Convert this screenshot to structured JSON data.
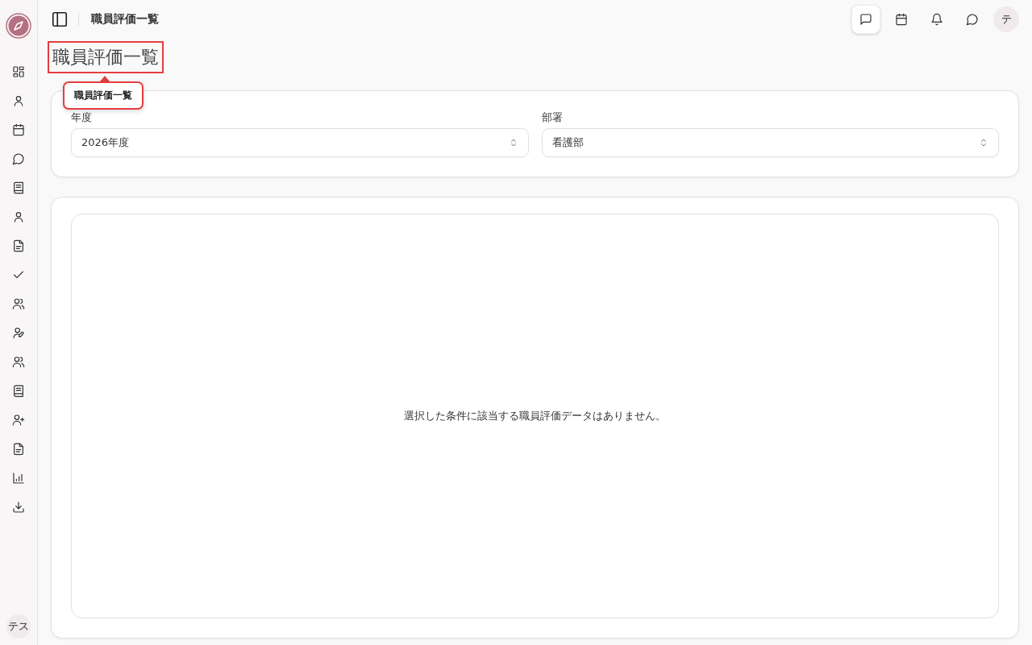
{
  "sidebar": {
    "items": [
      {
        "kind": "grid"
      },
      {
        "kind": "user"
      },
      {
        "kind": "calendar"
      },
      {
        "kind": "chat"
      },
      {
        "kind": "book"
      },
      {
        "kind": "user"
      },
      {
        "kind": "file"
      },
      {
        "kind": "check"
      },
      {
        "kind": "users"
      },
      {
        "kind": "user-pen"
      },
      {
        "kind": "users"
      },
      {
        "kind": "book"
      },
      {
        "kind": "user-plus"
      },
      {
        "kind": "file"
      },
      {
        "kind": "chart"
      },
      {
        "kind": "download"
      }
    ],
    "user_avatar": "テス"
  },
  "header": {
    "breadcrumb": "職員評価一覧",
    "actions": [
      {
        "kind": "message-square",
        "selected": true
      },
      {
        "kind": "calendar",
        "selected": false
      },
      {
        "kind": "bell",
        "selected": false
      },
      {
        "kind": "chat",
        "selected": false
      }
    ],
    "avatar": "テ"
  },
  "page": {
    "title": "職員評価一覧",
    "title_highlighted": true,
    "tooltip": "職員評価一覧"
  },
  "filters": [
    {
      "label": "年度",
      "value": "2026年度"
    },
    {
      "label": "部署",
      "value": "看護部"
    }
  ],
  "empty_message": "選択した条件に該当する職員評価データはありません。"
}
